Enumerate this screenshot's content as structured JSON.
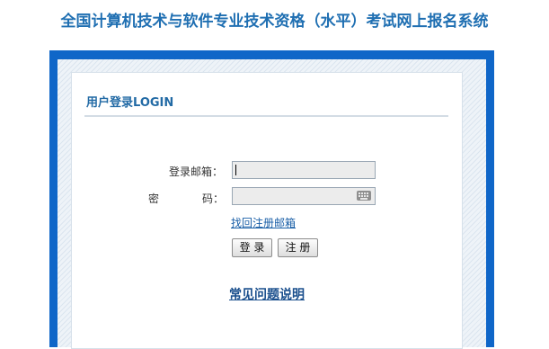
{
  "header": {
    "title": "全国计算机技术与软件专业技术资格（水平）考试网上报名系统"
  },
  "login": {
    "title": "用户登录LOGIN",
    "email_label": "登录邮箱：",
    "email_value": "",
    "password_label_1": "密",
    "password_label_2": "码：",
    "password_value": "",
    "recover_link": "找回注册邮箱",
    "login_button": "登 录",
    "register_button": "注 册",
    "faq_link": "常见问题说明"
  },
  "colors": {
    "title_blue": "#1f6fb2",
    "frame_blue": "#0f66c8",
    "link_blue": "#1a5fa7"
  }
}
